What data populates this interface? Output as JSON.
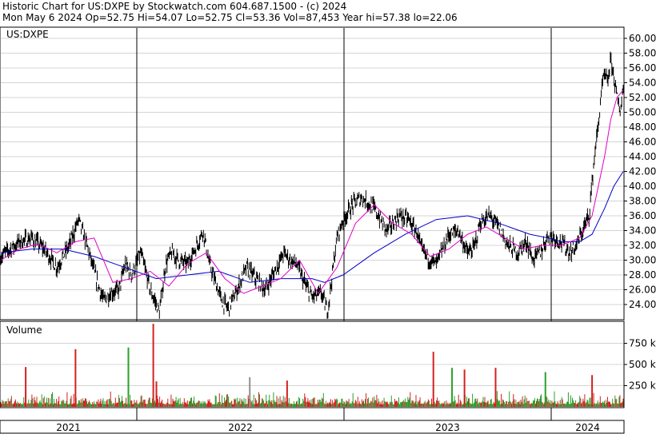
{
  "header": {
    "line1": "Historic Chart for US:DXPE by Stockwatch.com 604.687.1500 - (c) 2024",
    "line2": "Mon May  6 2024   Op=52.75   Hi=54.07   Lo=52.75   Cl=53.36   Vol=87,453   Year hi=57.38   lo=22.06"
  },
  "chart_data": [
    {
      "type": "line",
      "title": "US:DXPE",
      "y_ticks": [
        "60.00",
        "58.00",
        "56.00",
        "54.00",
        "52.00",
        "50.00",
        "48.00",
        "46.00",
        "44.00",
        "42.00",
        "40.00",
        "38.00",
        "36.00",
        "34.00",
        "32.00",
        "30.00",
        "28.00",
        "26.00",
        "24.00"
      ],
      "ylim": [
        22.06,
        61.0
      ],
      "x_labels": [
        "2021",
        "2022",
        "2023",
        "2024"
      ],
      "colors": {
        "price": "#000000",
        "ma_short": "#e000c8",
        "ma_long": "#0000c8",
        "grid": "#d4d4d4"
      },
      "series": [
        {
          "role": "price",
          "x": [
            0,
            0.03,
            0.05,
            0.07,
            0.09,
            0.11,
            0.125,
            0.14,
            0.155,
            0.165,
            0.175,
            0.19,
            0.2,
            0.21,
            0.225,
            0.24,
            0.255,
            0.265,
            0.275,
            0.285,
            0.3,
            0.315,
            0.325,
            0.335,
            0.345,
            0.355,
            0.365,
            0.38,
            0.395,
            0.41,
            0.425,
            0.44,
            0.455,
            0.465,
            0.475,
            0.49,
            0.5,
            0.515,
            0.525,
            0.54,
            0.55,
            0.565,
            0.58,
            0.6,
            0.62,
            0.64,
            0.655,
            0.67,
            0.675,
            0.69,
            0.7,
            0.72,
            0.735,
            0.75,
            0.76,
            0.77,
            0.785,
            0.8,
            0.815,
            0.83,
            0.845,
            0.855,
            0.87,
            0.88,
            0.9,
            0.915,
            0.925,
            0.935,
            0.945,
            0.955,
            0.96,
            0.965,
            0.97,
            0.975,
            0.98,
            0.985,
            0.99,
            0.995,
            1.0
          ],
          "y": [
            30.5,
            32.5,
            33.0,
            31.5,
            29.0,
            32.0,
            35.5,
            31.5,
            27.0,
            24.5,
            25.5,
            26.0,
            29.5,
            28.0,
            31.0,
            26.0,
            23.0,
            29.5,
            31.0,
            30.0,
            29.5,
            32.0,
            34.0,
            29.5,
            27.0,
            24.5,
            23.5,
            26.0,
            29.0,
            27.5,
            26.0,
            28.5,
            31.0,
            30.0,
            29.5,
            26.5,
            25.0,
            25.5,
            23.0,
            33.0,
            35.5,
            37.5,
            38.5,
            37.0,
            34.0,
            36.0,
            35.5,
            33.5,
            31.5,
            30.0,
            29.5,
            33.5,
            34.0,
            31.0,
            31.5,
            35.0,
            36.0,
            34.5,
            32.0,
            31.0,
            32.5,
            30.0,
            31.5,
            33.5,
            32.5,
            31.0,
            32.0,
            34.0,
            36.0,
            45.0,
            48.0,
            53.0,
            55.0,
            54.0,
            57.0,
            55.0,
            52.0,
            50.0,
            53.36
          ]
        },
        {
          "role": "ma_short",
          "x": [
            0,
            0.03,
            0.06,
            0.09,
            0.12,
            0.15,
            0.18,
            0.21,
            0.24,
            0.27,
            0.3,
            0.33,
            0.36,
            0.39,
            0.42,
            0.45,
            0.48,
            0.51,
            0.54,
            0.57,
            0.6,
            0.63,
            0.66,
            0.69,
            0.72,
            0.75,
            0.78,
            0.81,
            0.84,
            0.87,
            0.9,
            0.93,
            0.95,
            0.96,
            0.97,
            0.98,
            0.99,
            1.0
          ],
          "y": [
            30.0,
            31.5,
            32.2,
            31.0,
            32.5,
            33.0,
            27.0,
            27.5,
            28.5,
            26.5,
            29.5,
            31.0,
            27.5,
            25.5,
            26.5,
            27.5,
            30.0,
            25.5,
            29.0,
            35.0,
            37.5,
            35.0,
            33.5,
            30.5,
            31.5,
            33.5,
            34.5,
            33.0,
            31.5,
            32.0,
            32.0,
            33.0,
            36.0,
            40.0,
            44.0,
            49.0,
            52.0,
            53.0
          ]
        },
        {
          "role": "ma_long",
          "x": [
            0,
            0.05,
            0.1,
            0.15,
            0.2,
            0.25,
            0.3,
            0.35,
            0.4,
            0.45,
            0.5,
            0.52,
            0.55,
            0.6,
            0.65,
            0.7,
            0.75,
            0.8,
            0.85,
            0.88,
            0.9,
            0.93,
            0.95,
            0.97,
            0.985,
            1.0
          ],
          "y": [
            31.0,
            31.5,
            31.5,
            30.5,
            29.0,
            27.5,
            28.0,
            28.5,
            27.0,
            27.5,
            27.5,
            27.0,
            28.0,
            31.0,
            33.5,
            35.5,
            36.0,
            35.0,
            33.5,
            33.0,
            32.5,
            32.5,
            33.5,
            37.0,
            40.0,
            42.0
          ]
        }
      ]
    },
    {
      "type": "bar",
      "title": "Volume",
      "y_ticks": [
        "750 k",
        "500 k",
        "250 k"
      ],
      "ylim": [
        0,
        1000000
      ],
      "spike_values": [
        470000,
        680000,
        700000,
        980000,
        300000,
        350000,
        310000,
        650000,
        460000,
        440000,
        460000,
        410000,
        375000
      ],
      "spike_positions": [
        0.04,
        0.12,
        0.205,
        0.245,
        0.25,
        0.4,
        0.46,
        0.695,
        0.725,
        0.745,
        0.795,
        0.875,
        0.95
      ]
    }
  ]
}
